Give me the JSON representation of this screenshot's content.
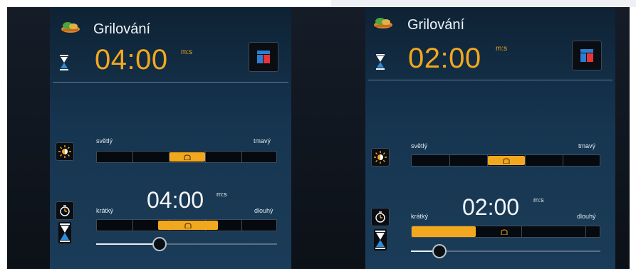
{
  "panels": [
    {
      "title": "Grilování",
      "time": "04:00",
      "time_unit": "m:s",
      "browning": {
        "light_label": "světlý",
        "dark_label": "tmavý",
        "level_segment": 3,
        "segments": 5
      },
      "duration": {
        "short_label": "krátký",
        "long_label": "dlouhý",
        "time": "04:00",
        "time_unit": "m:s",
        "level_fraction": 0.35
      }
    },
    {
      "title": "Grilování",
      "time": "02:00",
      "time_unit": "m:s",
      "browning": {
        "light_label": "světlý",
        "dark_label": "tmavý",
        "level_segment": 3,
        "segments": 5
      },
      "duration": {
        "short_label": "krátký",
        "long_label": "dlouhý",
        "time": "02:00",
        "time_unit": "m:s",
        "level_fraction": 0.15
      }
    }
  ],
  "icons": {
    "food": "grilled-food-icon",
    "hourglass": "hourglass-icon",
    "program": "program-switch-icon",
    "browning": "browning-sun-icon",
    "timer": "timer-icon",
    "toast": "toast-icon"
  },
  "colors": {
    "accent": "#f2a81e",
    "panel_top": "#0e2234",
    "panel_bottom": "#1b3c58",
    "hourglass_blue": "#2f8bd6",
    "program_red": "#e8333a",
    "program_blue": "#2a7fd2"
  }
}
